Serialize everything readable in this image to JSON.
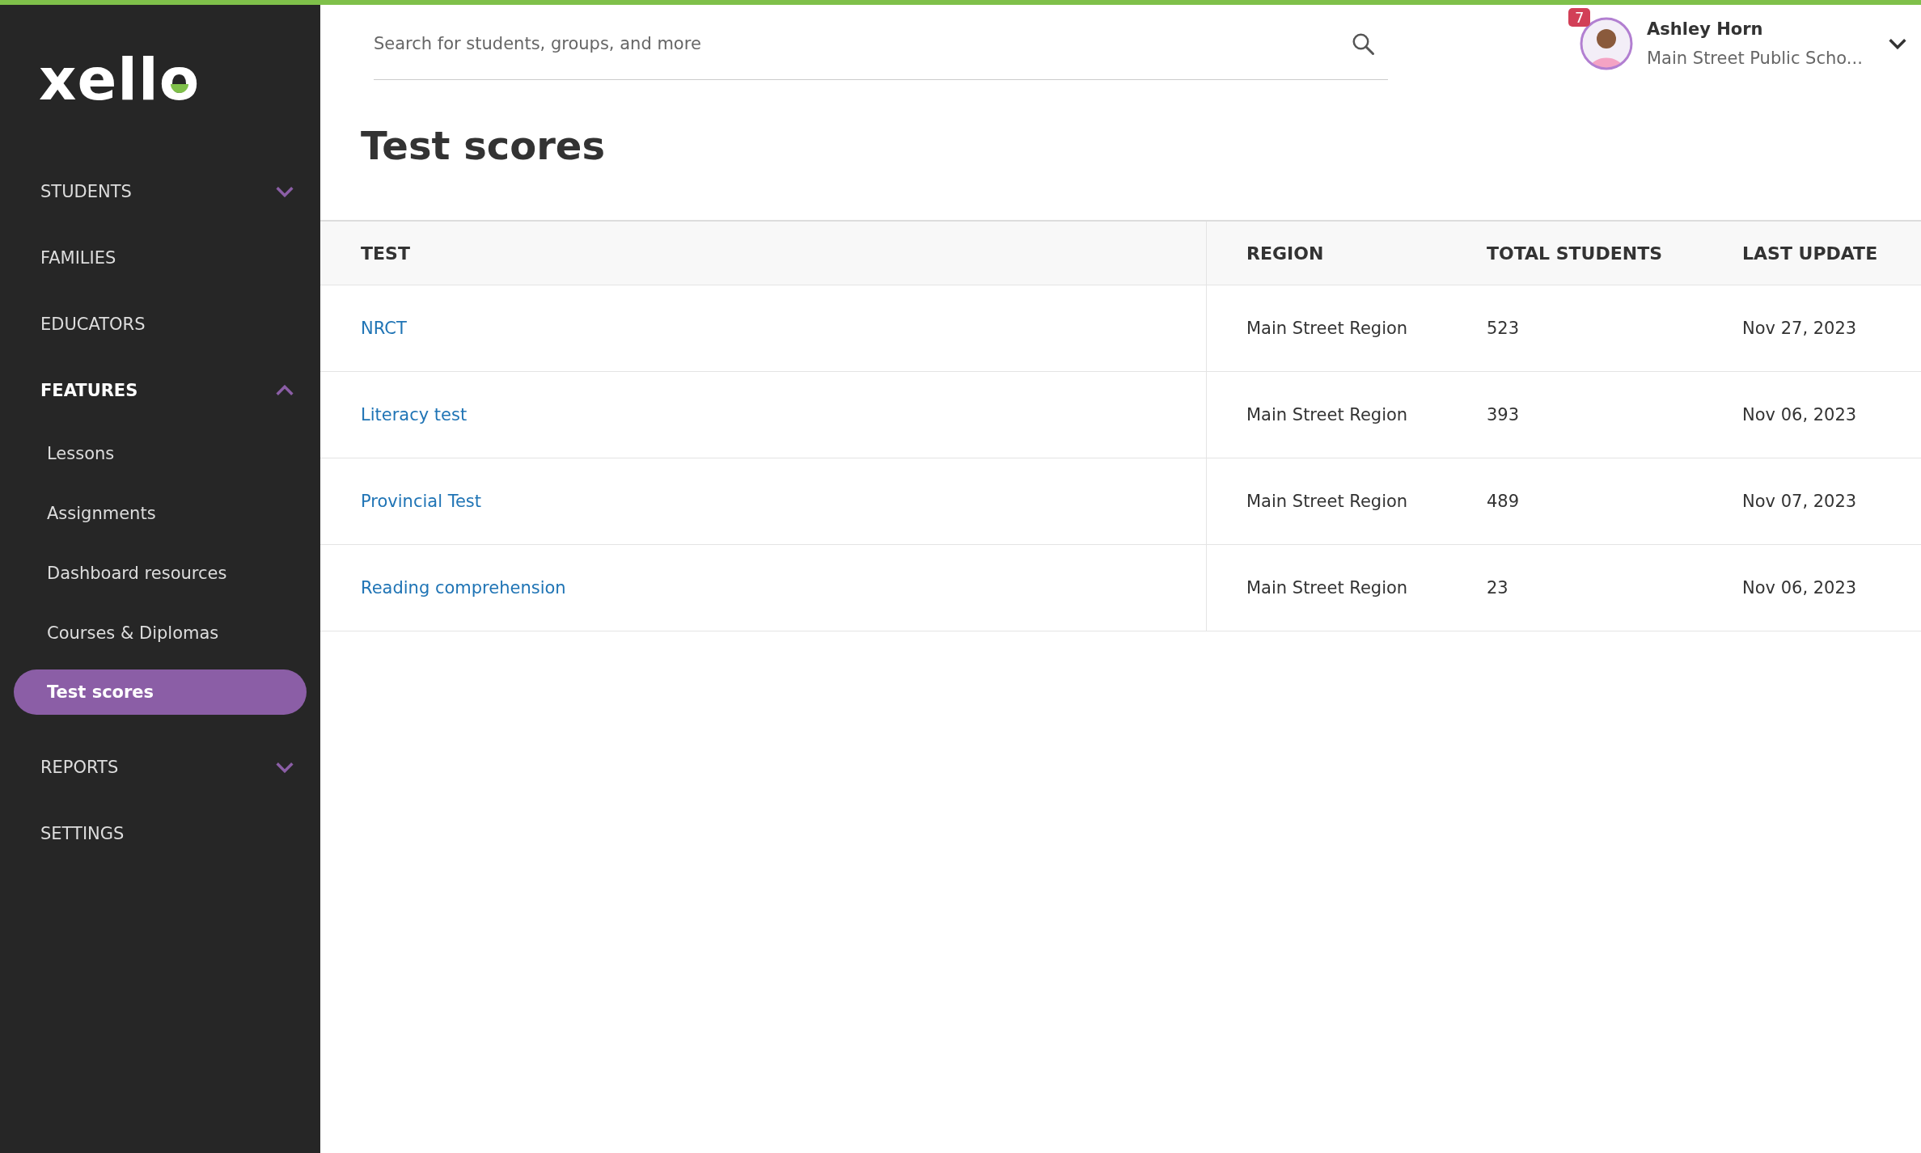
{
  "sidebar": {
    "logo": "xello",
    "items": [
      {
        "label": "STUDENTS",
        "kind": "group",
        "selected": false,
        "expanded": false
      },
      {
        "label": "FAMILIES",
        "kind": "link",
        "selected": false
      },
      {
        "label": "EDUCATORS",
        "kind": "link",
        "selected": false
      },
      {
        "label": "FEATURES",
        "kind": "group",
        "selected": true,
        "expanded": true,
        "children": [
          {
            "label": "Lessons",
            "selected": false
          },
          {
            "label": "Assignments",
            "selected": false
          },
          {
            "label": "Dashboard resources",
            "selected": false
          },
          {
            "label": "Courses & Diplomas",
            "selected": false
          },
          {
            "label": "Test scores",
            "selected": true
          }
        ]
      },
      {
        "label": "REPORTS",
        "kind": "group",
        "selected": false,
        "expanded": false
      },
      {
        "label": "SETTINGS",
        "kind": "link",
        "selected": false
      }
    ]
  },
  "search": {
    "placeholder": "Search for students, groups, and more"
  },
  "user": {
    "name": "Ashley Horn",
    "school": "Main Street Public Scho...",
    "notifications": "7"
  },
  "page_title": "Test scores",
  "table": {
    "columns": [
      "TEST",
      "REGION",
      "TOTAL STUDENTS",
      "LAST UPDATE"
    ],
    "rows": [
      {
        "test": "NRCT",
        "region": "Main Street Region",
        "total": "523",
        "updated": "Nov 27, 2023"
      },
      {
        "test": "Literacy test",
        "region": "Main Street Region",
        "total": "393",
        "updated": "Nov 06, 2023"
      },
      {
        "test": "Provincial Test",
        "region": "Main Street Region",
        "total": "489",
        "updated": "Nov 07, 2023"
      },
      {
        "test": "Reading comprehension",
        "region": "Main Street Region",
        "total": "23",
        "updated": "Nov 06, 2023"
      }
    ]
  }
}
